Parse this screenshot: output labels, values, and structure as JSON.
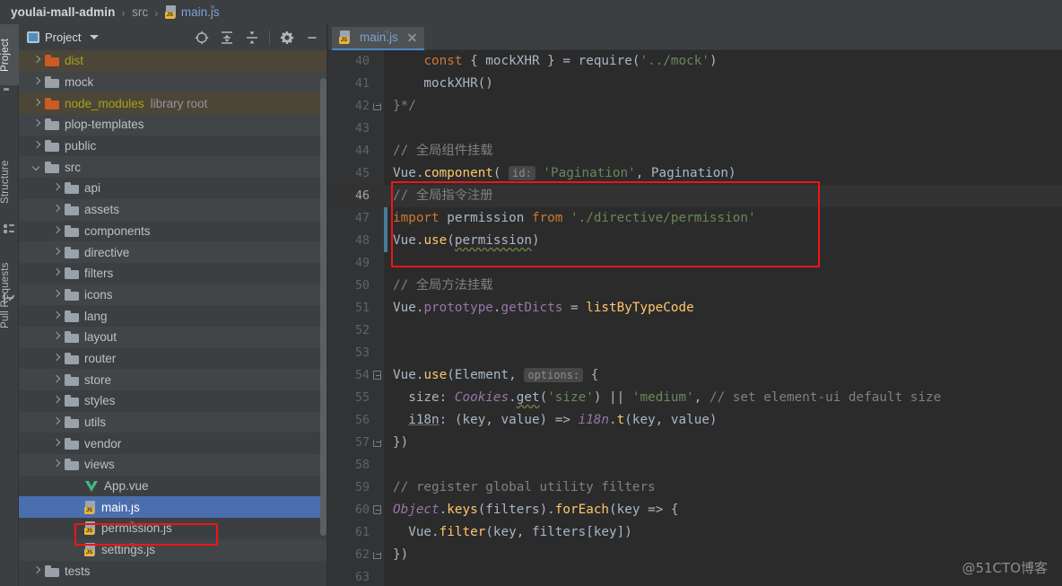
{
  "breadcrumb": {
    "root": "youlai-mall-admin",
    "sep": "›",
    "middle": "src",
    "leaf": "main.js",
    "leaf_icon": "js-file-icon"
  },
  "tool_strip": {
    "tabs": [
      {
        "label": "Project",
        "icon": "project-icon",
        "active": true
      },
      {
        "label": "Structure",
        "icon": "structure-icon",
        "active": false
      },
      {
        "label": "Pull Requests",
        "icon": "pull-requests-icon",
        "active": false
      }
    ]
  },
  "project_panel": {
    "title": "Project",
    "title_icon": "project-view-icon",
    "dropdown_icon": "chevron-down-icon",
    "toolbar": [
      {
        "name": "select-opened-file-icon",
        "tooltip": "Select Opened File"
      },
      {
        "name": "expand-all-icon",
        "tooltip": "Expand All"
      },
      {
        "name": "collapse-all-icon",
        "tooltip": "Collapse All"
      },
      {
        "name": "settings-gear-icon",
        "tooltip": "Settings"
      },
      {
        "name": "hide-panel-icon",
        "tooltip": "Hide"
      }
    ],
    "tree": [
      {
        "label": "dist",
        "type": "folder",
        "indent": 1,
        "state": "collapsed",
        "style": "excluded",
        "note": ""
      },
      {
        "label": "mock",
        "type": "folder",
        "indent": 1,
        "state": "collapsed",
        "style": "normal",
        "note": ""
      },
      {
        "label": "node_modules",
        "type": "folder",
        "indent": 1,
        "state": "collapsed",
        "style": "excluded",
        "note": "library root"
      },
      {
        "label": "plop-templates",
        "type": "folder",
        "indent": 1,
        "state": "collapsed",
        "style": "normal",
        "note": ""
      },
      {
        "label": "public",
        "type": "folder",
        "indent": 1,
        "state": "collapsed",
        "style": "normal",
        "note": ""
      },
      {
        "label": "src",
        "type": "folder",
        "indent": 1,
        "state": "expanded",
        "style": "normal",
        "note": ""
      },
      {
        "label": "api",
        "type": "folder",
        "indent": 2,
        "state": "collapsed",
        "style": "normal",
        "note": ""
      },
      {
        "label": "assets",
        "type": "folder",
        "indent": 2,
        "state": "collapsed",
        "style": "normal",
        "note": ""
      },
      {
        "label": "components",
        "type": "folder",
        "indent": 2,
        "state": "collapsed",
        "style": "normal",
        "note": ""
      },
      {
        "label": "directive",
        "type": "folder",
        "indent": 2,
        "state": "collapsed",
        "style": "normal",
        "note": ""
      },
      {
        "label": "filters",
        "type": "folder",
        "indent": 2,
        "state": "collapsed",
        "style": "normal",
        "note": ""
      },
      {
        "label": "icons",
        "type": "folder",
        "indent": 2,
        "state": "collapsed",
        "style": "normal",
        "note": ""
      },
      {
        "label": "lang",
        "type": "folder",
        "indent": 2,
        "state": "collapsed",
        "style": "normal",
        "note": ""
      },
      {
        "label": "layout",
        "type": "folder",
        "indent": 2,
        "state": "collapsed",
        "style": "normal",
        "note": ""
      },
      {
        "label": "router",
        "type": "folder",
        "indent": 2,
        "state": "collapsed",
        "style": "normal",
        "note": ""
      },
      {
        "label": "store",
        "type": "folder",
        "indent": 2,
        "state": "collapsed",
        "style": "normal",
        "note": ""
      },
      {
        "label": "styles",
        "type": "folder",
        "indent": 2,
        "state": "collapsed",
        "style": "normal",
        "note": ""
      },
      {
        "label": "utils",
        "type": "folder",
        "indent": 2,
        "state": "collapsed",
        "style": "normal",
        "note": ""
      },
      {
        "label": "vendor",
        "type": "folder",
        "indent": 2,
        "state": "collapsed",
        "style": "normal",
        "note": ""
      },
      {
        "label": "views",
        "type": "folder",
        "indent": 2,
        "state": "collapsed",
        "style": "normal",
        "note": ""
      },
      {
        "label": "App.vue",
        "type": "vue",
        "indent": 3,
        "state": "leaf",
        "style": "normal",
        "note": ""
      },
      {
        "label": "main.js",
        "type": "js",
        "indent": 3,
        "state": "leaf",
        "style": "normal",
        "note": "",
        "selected": true,
        "highlighted": true
      },
      {
        "label": "permission.js",
        "type": "js",
        "indent": 3,
        "state": "leaf",
        "style": "normal",
        "note": ""
      },
      {
        "label": "settings.js",
        "type": "js",
        "indent": 3,
        "state": "leaf",
        "style": "normal",
        "note": ""
      },
      {
        "label": "tests",
        "type": "folder",
        "indent": 1,
        "state": "collapsed",
        "style": "normal",
        "note": ""
      }
    ]
  },
  "editor": {
    "tab": {
      "label": "main.js",
      "icon": "js-file-icon",
      "close_icon": "close-icon"
    },
    "caret_line": 46,
    "highlight_lines": [
      46,
      47,
      48
    ],
    "lines": [
      {
        "n": 40,
        "fold": "",
        "tokens": [
          {
            "t": "    ",
            "c": "t-id"
          },
          {
            "t": "const",
            "c": "t-kw"
          },
          {
            "t": " { mockXHR } = ",
            "c": "t-id"
          },
          {
            "t": "require",
            "c": "t-id"
          },
          {
            "t": "(",
            "c": "t-id"
          },
          {
            "t": "'../mock'",
            "c": "t-str"
          },
          {
            "t": ")",
            "c": "t-id"
          }
        ]
      },
      {
        "n": 41,
        "fold": "",
        "tokens": [
          {
            "t": "    mockXHR()",
            "c": "t-id"
          }
        ]
      },
      {
        "n": 42,
        "fold": "end",
        "tokens": [
          {
            "t": "}*/",
            "c": "t-cmt"
          }
        ]
      },
      {
        "n": 43,
        "fold": "",
        "tokens": []
      },
      {
        "n": 44,
        "fold": "",
        "tokens": [
          {
            "t": "// 全局组件挂载",
            "c": "t-cmt"
          }
        ]
      },
      {
        "n": 45,
        "fold": "",
        "tokens": [
          {
            "t": "Vue",
            "c": "t-id"
          },
          {
            "t": ".",
            "c": "t-id"
          },
          {
            "t": "component",
            "c": "t-fn"
          },
          {
            "t": "( ",
            "c": "t-id"
          },
          {
            "t": "id:",
            "c": "inlay"
          },
          {
            "t": " ",
            "c": "t-id"
          },
          {
            "t": "'Pagination'",
            "c": "t-str"
          },
          {
            "t": ", Pagination)",
            "c": "t-id"
          }
        ]
      },
      {
        "n": 46,
        "fold": "",
        "tokens": [
          {
            "t": "// 全局指令注册",
            "c": "t-cmt"
          }
        ]
      },
      {
        "n": 47,
        "fold": "",
        "tokens": [
          {
            "t": "import",
            "c": "t-kw"
          },
          {
            "t": " permission ",
            "c": "t-id"
          },
          {
            "t": "from",
            "c": "t-kw"
          },
          {
            "t": " ",
            "c": "t-id"
          },
          {
            "t": "'./directive/permission'",
            "c": "t-str"
          }
        ]
      },
      {
        "n": 48,
        "fold": "",
        "tokens": [
          {
            "t": "Vue",
            "c": "t-id"
          },
          {
            "t": ".",
            "c": "t-id"
          },
          {
            "t": "use",
            "c": "t-fn"
          },
          {
            "t": "(",
            "c": "t-id"
          },
          {
            "t": "permission",
            "c": "t-id squiggle"
          },
          {
            "t": ")",
            "c": "t-id"
          }
        ]
      },
      {
        "n": 49,
        "fold": "",
        "tokens": []
      },
      {
        "n": 50,
        "fold": "",
        "tokens": [
          {
            "t": "// 全局方法挂载",
            "c": "t-cmt"
          }
        ]
      },
      {
        "n": 51,
        "fold": "",
        "tokens": [
          {
            "t": "Vue",
            "c": "t-id"
          },
          {
            "t": ".",
            "c": "t-id"
          },
          {
            "t": "prototype",
            "c": "t-field"
          },
          {
            "t": ".",
            "c": "t-id"
          },
          {
            "t": "getDicts",
            "c": "t-field"
          },
          {
            "t": " = ",
            "c": "t-id"
          },
          {
            "t": "listByTypeCode",
            "c": "t-fn"
          }
        ]
      },
      {
        "n": 52,
        "fold": "",
        "tokens": []
      },
      {
        "n": 53,
        "fold": "",
        "tokens": []
      },
      {
        "n": 54,
        "fold": "start",
        "tokens": [
          {
            "t": "Vue",
            "c": "t-id"
          },
          {
            "t": ".",
            "c": "t-id"
          },
          {
            "t": "use",
            "c": "t-fn"
          },
          {
            "t": "(Element, ",
            "c": "t-id"
          },
          {
            "t": "options:",
            "c": "inlay"
          },
          {
            "t": " {",
            "c": "t-id"
          }
        ]
      },
      {
        "n": 55,
        "fold": "",
        "tokens": [
          {
            "t": "  size: ",
            "c": "t-id"
          },
          {
            "t": "Cookies",
            "c": "t-static"
          },
          {
            "t": ".",
            "c": "t-id"
          },
          {
            "t": "get",
            "c": "t-id squiggle"
          },
          {
            "t": "(",
            "c": "t-id"
          },
          {
            "t": "'size'",
            "c": "t-str"
          },
          {
            "t": ") || ",
            "c": "t-id"
          },
          {
            "t": "'medium'",
            "c": "t-str"
          },
          {
            "t": ", ",
            "c": "t-id"
          },
          {
            "t": "// set element-ui default size",
            "c": "t-cmt"
          }
        ]
      },
      {
        "n": 56,
        "fold": "",
        "tokens": [
          {
            "t": "  ",
            "c": "t-id"
          },
          {
            "t": "i18n",
            "c": "t-id t-under"
          },
          {
            "t": ": (key, value) => ",
            "c": "t-id"
          },
          {
            "t": "i18n",
            "c": "t-prop-i"
          },
          {
            "t": ".",
            "c": "t-id"
          },
          {
            "t": "t",
            "c": "t-fn"
          },
          {
            "t": "(key, value)",
            "c": "t-id"
          }
        ]
      },
      {
        "n": 57,
        "fold": "end",
        "tokens": [
          {
            "t": "})",
            "c": "t-id"
          }
        ]
      },
      {
        "n": 58,
        "fold": "",
        "tokens": []
      },
      {
        "n": 59,
        "fold": "",
        "tokens": [
          {
            "t": "// register global utility filters",
            "c": "t-cmt"
          }
        ]
      },
      {
        "n": 60,
        "fold": "start",
        "tokens": [
          {
            "t": "Object",
            "c": "t-static"
          },
          {
            "t": ".",
            "c": "t-id"
          },
          {
            "t": "keys",
            "c": "t-fn"
          },
          {
            "t": "(filters)",
            "c": "t-id"
          },
          {
            "t": ".",
            "c": "t-id"
          },
          {
            "t": "forEach",
            "c": "t-fn"
          },
          {
            "t": "(key => {",
            "c": "t-id"
          }
        ]
      },
      {
        "n": 61,
        "fold": "",
        "tokens": [
          {
            "t": "  Vue",
            "c": "t-id"
          },
          {
            "t": ".",
            "c": "t-id"
          },
          {
            "t": "filter",
            "c": "t-fn"
          },
          {
            "t": "(key, filters[key])",
            "c": "t-id"
          }
        ]
      },
      {
        "n": 62,
        "fold": "end",
        "tokens": [
          {
            "t": "})",
            "c": "t-id"
          }
        ]
      },
      {
        "n": 63,
        "fold": "",
        "tokens": []
      }
    ]
  },
  "watermark": "@51CTO博客",
  "colors": {
    "panel_bg": "#3c3f41",
    "editor_bg": "#2b2b2b",
    "gutter_bg": "#313335",
    "selection_blue": "#4b6eaf",
    "highlight_red": "#f11515",
    "excluded_olive": "#a5a21a",
    "tab_underline": "#4a88c7",
    "string_green": "#6a8759",
    "keyword_orange": "#cc7832",
    "function_yellow": "#ffc66d",
    "field_purple": "#9876aa",
    "comment_gray": "#808080"
  }
}
